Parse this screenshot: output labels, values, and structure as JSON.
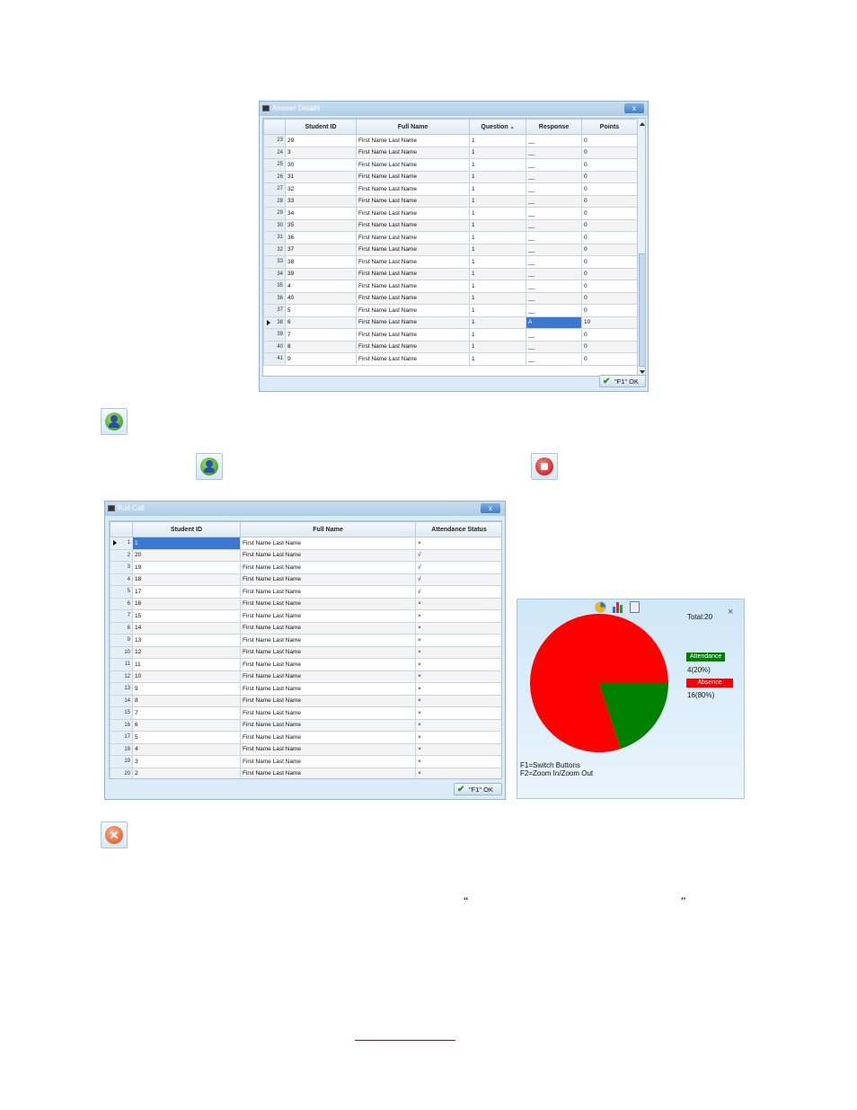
{
  "answer_details": {
    "title": "Answer Details",
    "close_label": "x",
    "columns": [
      "Student ID",
      "Full Name",
      "Question",
      "Response",
      "Points"
    ],
    "sort_indicator": "▲",
    "rows": [
      {
        "n": "23",
        "id": "29",
        "name": "First Name Last Name",
        "q": "1",
        "resp": "__",
        "pts": "0"
      },
      {
        "n": "24",
        "id": "3",
        "name": "First Name Last Name",
        "q": "1",
        "resp": "__",
        "pts": "0"
      },
      {
        "n": "25",
        "id": "30",
        "name": "First Name Last Name",
        "q": "1",
        "resp": "__",
        "pts": "0"
      },
      {
        "n": "26",
        "id": "31",
        "name": "First Name Last Name",
        "q": "1",
        "resp": "__",
        "pts": "0"
      },
      {
        "n": "27",
        "id": "32",
        "name": "First Name Last Name",
        "q": "1",
        "resp": "__",
        "pts": "0"
      },
      {
        "n": "28",
        "id": "33",
        "name": "First Name Last Name",
        "q": "1",
        "resp": "__",
        "pts": "0"
      },
      {
        "n": "29",
        "id": "34",
        "name": "First Name Last Name",
        "q": "1",
        "resp": "__",
        "pts": "0"
      },
      {
        "n": "30",
        "id": "35",
        "name": "First Name Last Name",
        "q": "1",
        "resp": "__",
        "pts": "0"
      },
      {
        "n": "31",
        "id": "36",
        "name": "First Name Last Name",
        "q": "1",
        "resp": "__",
        "pts": "0"
      },
      {
        "n": "32",
        "id": "37",
        "name": "First Name Last Name",
        "q": "1",
        "resp": "__",
        "pts": "0"
      },
      {
        "n": "33",
        "id": "38",
        "name": "First Name Last Name",
        "q": "1",
        "resp": "__",
        "pts": "0"
      },
      {
        "n": "34",
        "id": "39",
        "name": "First Name Last Name",
        "q": "1",
        "resp": "__",
        "pts": "0"
      },
      {
        "n": "35",
        "id": "4",
        "name": "First Name Last Name",
        "q": "1",
        "resp": "__",
        "pts": "0"
      },
      {
        "n": "36",
        "id": "40",
        "name": "First Name Last Name",
        "q": "1",
        "resp": "__",
        "pts": "0"
      },
      {
        "n": "37",
        "id": "5",
        "name": "First Name Last Name",
        "q": "1",
        "resp": "__",
        "pts": "0"
      },
      {
        "n": "38",
        "id": "6",
        "name": "First Name Last Name",
        "q": "1",
        "resp": "A",
        "pts": "10",
        "selected": true
      },
      {
        "n": "39",
        "id": "7",
        "name": "First Name Last Name",
        "q": "1",
        "resp": "__",
        "pts": "0"
      },
      {
        "n": "40",
        "id": "8",
        "name": "First Name Last Name",
        "q": "1",
        "resp": "__",
        "pts": "0"
      },
      {
        "n": "41",
        "id": "9",
        "name": "First Name Last Name",
        "q": "1",
        "resp": "__",
        "pts": "0"
      }
    ],
    "ok_label": "\"F1\" OK"
  },
  "roll_call": {
    "title": "Roll Call",
    "close_label": "x",
    "columns": [
      "Student ID",
      "Full Name",
      "Attendance Status"
    ],
    "rows": [
      {
        "n": "1",
        "id": "1",
        "name": "First Name Last Name",
        "status": "×",
        "selected": true
      },
      {
        "n": "2",
        "id": "20",
        "name": "First Name Last Name",
        "status": "√"
      },
      {
        "n": "3",
        "id": "19",
        "name": "First Name Last Name",
        "status": "√"
      },
      {
        "n": "4",
        "id": "18",
        "name": "First Name Last Name",
        "status": "√"
      },
      {
        "n": "5",
        "id": "17",
        "name": "First Name Last Name",
        "status": "√"
      },
      {
        "n": "6",
        "id": "16",
        "name": "First Name Last Name",
        "status": "×"
      },
      {
        "n": "7",
        "id": "15",
        "name": "First Name Last Name",
        "status": "×"
      },
      {
        "n": "8",
        "id": "14",
        "name": "First Name Last Name",
        "status": "×"
      },
      {
        "n": "9",
        "id": "13",
        "name": "First Name Last Name",
        "status": "×"
      },
      {
        "n": "10",
        "id": "12",
        "name": "First Name Last Name",
        "status": "×"
      },
      {
        "n": "11",
        "id": "11",
        "name": "First Name Last Name",
        "status": "×"
      },
      {
        "n": "12",
        "id": "10",
        "name": "First Name Last Name",
        "status": "×"
      },
      {
        "n": "13",
        "id": "9",
        "name": "First Name Last Name",
        "status": "×"
      },
      {
        "n": "14",
        "id": "8",
        "name": "First Name Last Name",
        "status": "×"
      },
      {
        "n": "15",
        "id": "7",
        "name": "First Name Last Name",
        "status": "×"
      },
      {
        "n": "16",
        "id": "6",
        "name": "First Name Last Name",
        "status": "×"
      },
      {
        "n": "17",
        "id": "5",
        "name": "First Name Last Name",
        "status": "×"
      },
      {
        "n": "18",
        "id": "4",
        "name": "First Name Last Name",
        "status": "×"
      },
      {
        "n": "19",
        "id": "3",
        "name": "First Name Last Name",
        "status": "×"
      },
      {
        "n": "20",
        "id": "2",
        "name": "First Name Last Name",
        "status": "×"
      }
    ],
    "ok_label": "\"F1\" OK"
  },
  "chart_panel": {
    "close_label": "×",
    "toolbar_icons": [
      "pie-chart-icon",
      "bar-chart-icon",
      "clipboard-icon"
    ],
    "total": "Total:20",
    "attendance_label": "Attendance",
    "attendance_value": "4(20%)",
    "absence_label": "Absence",
    "absence_value": "16(80%)",
    "help_line1": "F1=Switch Buttons",
    "help_line2": "F2=Zoom In/Zoom Out",
    "colors": {
      "attendance": "#008000",
      "absence": "#ff0000"
    }
  },
  "chart_data": {
    "type": "pie",
    "categories": [
      "Attendance",
      "Absence"
    ],
    "values": [
      4,
      16
    ],
    "title": "Total:20"
  },
  "page_icons": [
    "start-roll-call-icon",
    "roll-call-inline-icon",
    "stop-icon",
    "cancel-icon"
  ],
  "open_quote": "“",
  "close_quote": "”"
}
